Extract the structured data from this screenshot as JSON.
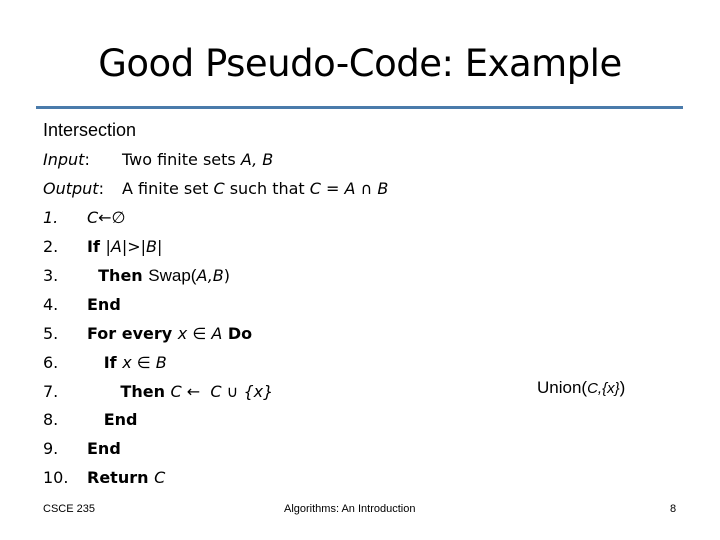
{
  "slide": {
    "title": "Good Pseudo-Code: Example",
    "heading": "Intersection",
    "input_label": "Input",
    "input_text": "Two finite sets ",
    "input_vars": "A, B",
    "output_label": "Output",
    "output_text": "A finite set ",
    "output_c": "C",
    "output_mid": " such that ",
    "output_eq": "C = A ∩ B",
    "lines": [
      {
        "num": "1.",
        "kw": "",
        "code": "C←∅"
      },
      {
        "num": "2.",
        "kw": "If ",
        "code": "|A|>|B|"
      },
      {
        "num": "3.",
        "kw": "  Then ",
        "code_plain": "Swap(",
        "code": "A,B",
        "code_end": ")"
      },
      {
        "num": "4.",
        "kw": "End",
        "code": ""
      },
      {
        "num": "5.",
        "kw": "For every ",
        "code": "x ∈ A",
        "kw2": " Do"
      },
      {
        "num": "6.",
        "kw": "   If ",
        "code": "x ∈ B"
      },
      {
        "num": "7.",
        "kw": "      Then ",
        "code": "C ←  C ∪ {x}"
      },
      {
        "num": "8.",
        "kw": "   End",
        "code": ""
      },
      {
        "num": "9.",
        "kw": "End",
        "code": ""
      },
      {
        "num": "10.",
        "kw": "Return ",
        "code": "C"
      }
    ],
    "side_note_plain": "Union(",
    "side_note_italic": "C,{x}",
    "side_note_end": ")"
  },
  "footer": {
    "course": "CSCE 235",
    "topic": "Algorithms: An Introduction",
    "page": "8"
  }
}
